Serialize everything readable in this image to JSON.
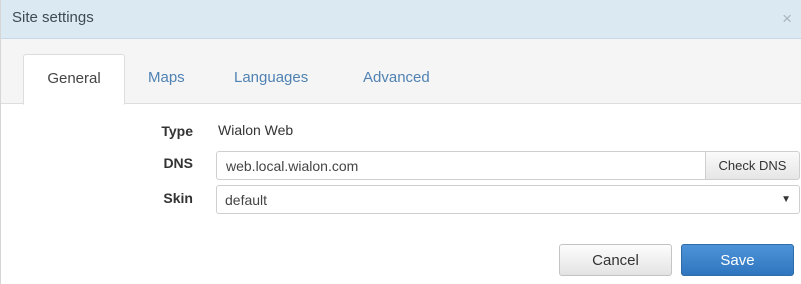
{
  "dialog": {
    "title": "Site settings",
    "close_glyph": "×",
    "close_icon": "close-icon"
  },
  "tabs": [
    {
      "label": "General",
      "active": true
    },
    {
      "label": "Maps",
      "active": false
    },
    {
      "label": "Languages",
      "active": false
    },
    {
      "label": "Advanced",
      "active": false
    }
  ],
  "form": {
    "type_label": "Type",
    "type_value": "Wialon Web",
    "dns_label": "DNS",
    "dns_value": "web.local.wialon.com",
    "check_dns_label": "Check DNS",
    "skin_label": "Skin",
    "skin_value": "default",
    "skin_arrow_glyph": "▼",
    "skin_arrow_icon": "dropdown-arrow-icon"
  },
  "actions": {
    "cancel_label": "Cancel",
    "save_label": "Save"
  },
  "colors": {
    "titlebar_bg": "#dbe9f2",
    "tab_link": "#4f82b3",
    "save_button": "#3a82c9"
  }
}
